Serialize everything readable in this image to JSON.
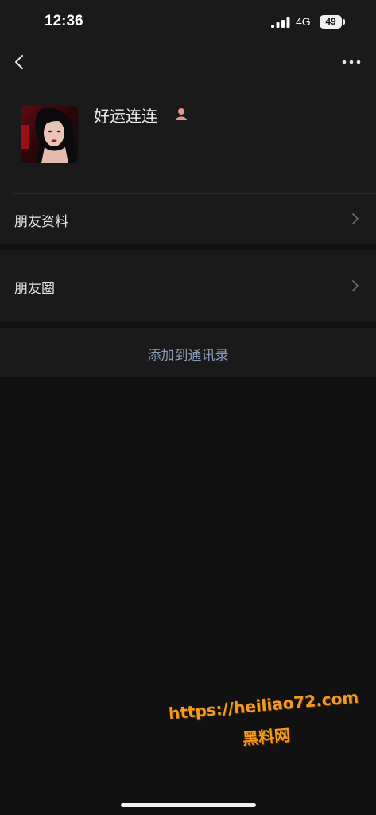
{
  "status_bar": {
    "time": "12:36",
    "network": "4G",
    "battery": "49",
    "icons": [
      "signal-icon",
      "battery-icon"
    ]
  },
  "nav": {
    "back_icon": "chevron-left-icon",
    "more_icon": "more-dots-icon"
  },
  "profile": {
    "name": "好运连连",
    "gender_icon": "female-user-icon",
    "avatar": "profile-photo"
  },
  "rows": [
    {
      "label": "朋友资料",
      "icon": "chevron-right-icon"
    },
    {
      "label": "朋友圈",
      "icon": "chevron-right-icon"
    }
  ],
  "actions": {
    "add_contact_label": "添加到通讯录"
  },
  "watermark": {
    "url": "https://heiliao72.com",
    "name": "黑料网"
  },
  "colors": {
    "background": "#111111",
    "card": "#1a1a1a",
    "link": "#8a9bb8",
    "watermark": "#f39a1f"
  }
}
